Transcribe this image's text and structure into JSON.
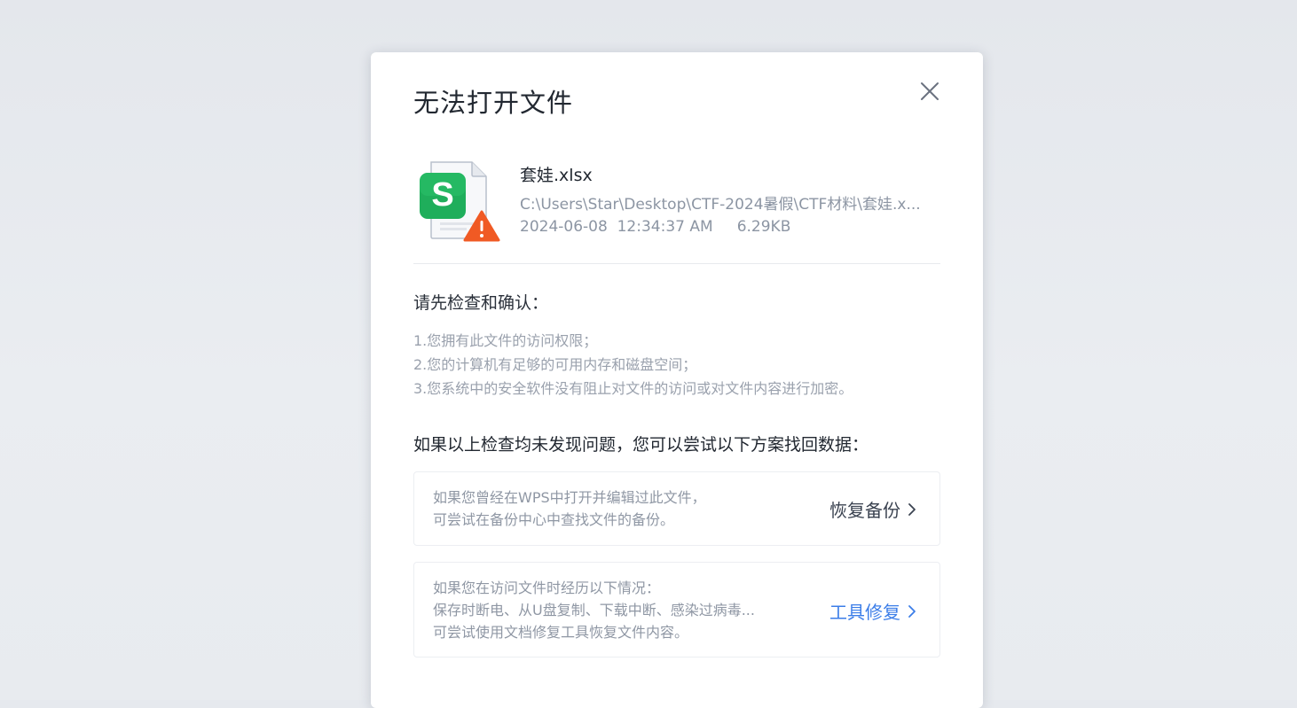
{
  "dialog": {
    "title": "无法打开文件",
    "close_icon": "close-icon"
  },
  "file": {
    "icon": "spreadsheet-file-warning-icon",
    "icon_letter": "S",
    "name": "套娃.xlsx",
    "path": "C:\\Users\\Star\\Desktop\\CTF-2024暑假\\CTF材料\\套娃.x...",
    "date": "2024-06-08",
    "time": "12:34:37 AM",
    "size": "6.29KB"
  },
  "checks": {
    "title": "请先检查和确认：",
    "items": [
      "1.您拥有此文件的访问权限；",
      "2.您的计算机有足够的可用内存和磁盘空间；",
      "3.您系统中的安全软件没有阻止对文件的访问或对文件内容进行加密。"
    ]
  },
  "recovery": {
    "title": "如果以上检查均未发现问题，您可以尝试以下方案找回数据：",
    "options": [
      {
        "lines": [
          "如果您曾经在WPS中打开并编辑过此文件，",
          "可尝试在备份中心中查找文件的备份。"
        ],
        "action": "恢复备份"
      },
      {
        "lines": [
          "如果您在访问文件时经历以下情况：",
          "保存时断电、从U盘复制、下载中断、感染过病毒...",
          "可尝试使用文档修复工具恢复文件内容。"
        ],
        "action": "工具修复"
      }
    ]
  },
  "colors": {
    "link_blue": "#3b7de8",
    "warning_orange": "#f05a24",
    "spreadsheet_green": "#1fae5b"
  }
}
